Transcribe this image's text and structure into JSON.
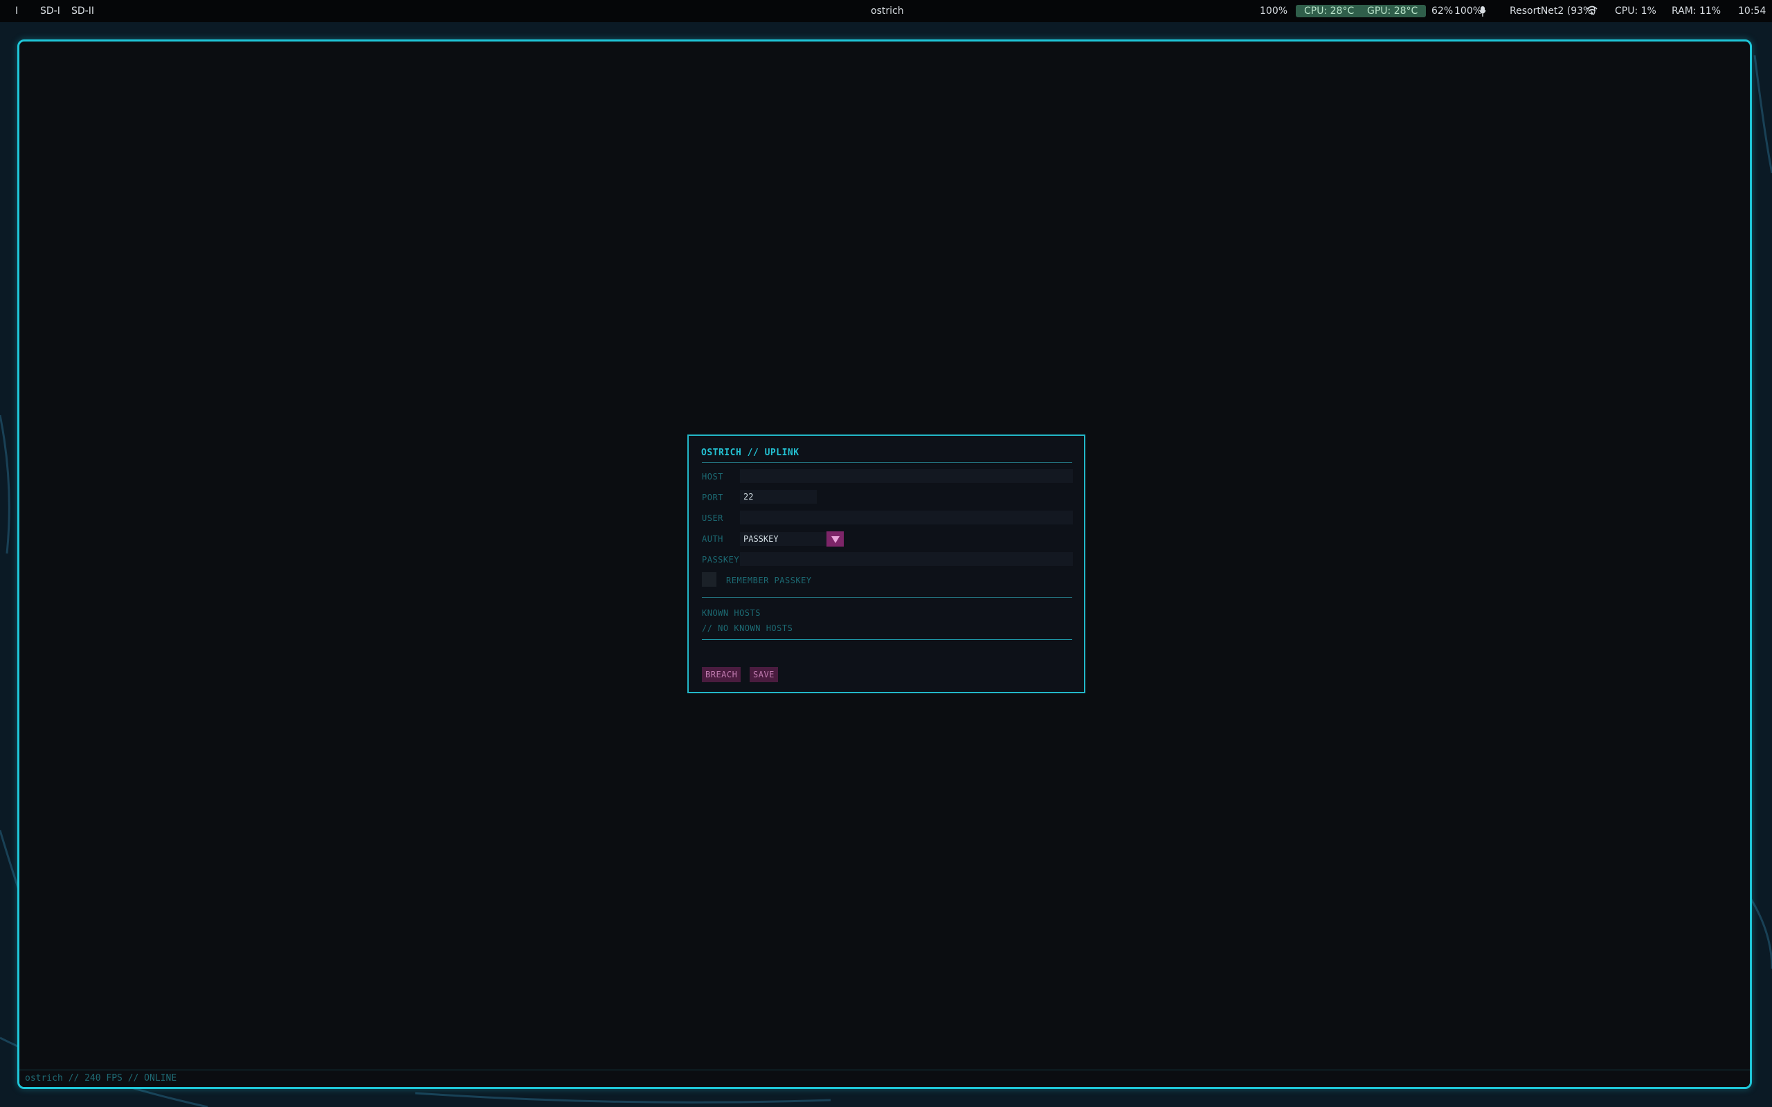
{
  "topbar": {
    "workspace_indicator": "I",
    "workspaces": [
      "SD-I",
      "SD-II"
    ],
    "window_title": "ostrich",
    "volume": "100%",
    "cpu_temp": "CPU: 28°C",
    "gpu_temp": "GPU: 28°C",
    "brightness": "62%",
    "mic_level": "100%",
    "network": "ResortNet2 (93%)",
    "cpu_usage": "CPU: 1%",
    "ram_usage": "RAM: 11%",
    "clock": "10:54"
  },
  "dialog": {
    "title": "OSTRICH // UPLINK",
    "host_label": "HOST",
    "host_value": "",
    "port_label": "PORT",
    "port_value": "22",
    "user_label": "USER",
    "user_value": "",
    "auth_label": "AUTH",
    "auth_value": "PASSKEY",
    "passkey_label": "PASSKEY",
    "passkey_value": "",
    "remember_label": "REMEMBER PASSKEY",
    "remember_checked": false,
    "known_hosts_label": "KNOWN HOSTS",
    "known_hosts_empty": "// NO KNOWN HOSTS",
    "breach_label": "BREACH",
    "save_label": "SAVE"
  },
  "status": {
    "text": "ostrich // 240 FPS // ONLINE"
  },
  "colors": {
    "accent": "#1fc6d8",
    "magenta": "#7d2568",
    "temp_pill": "#2f5e4a"
  }
}
